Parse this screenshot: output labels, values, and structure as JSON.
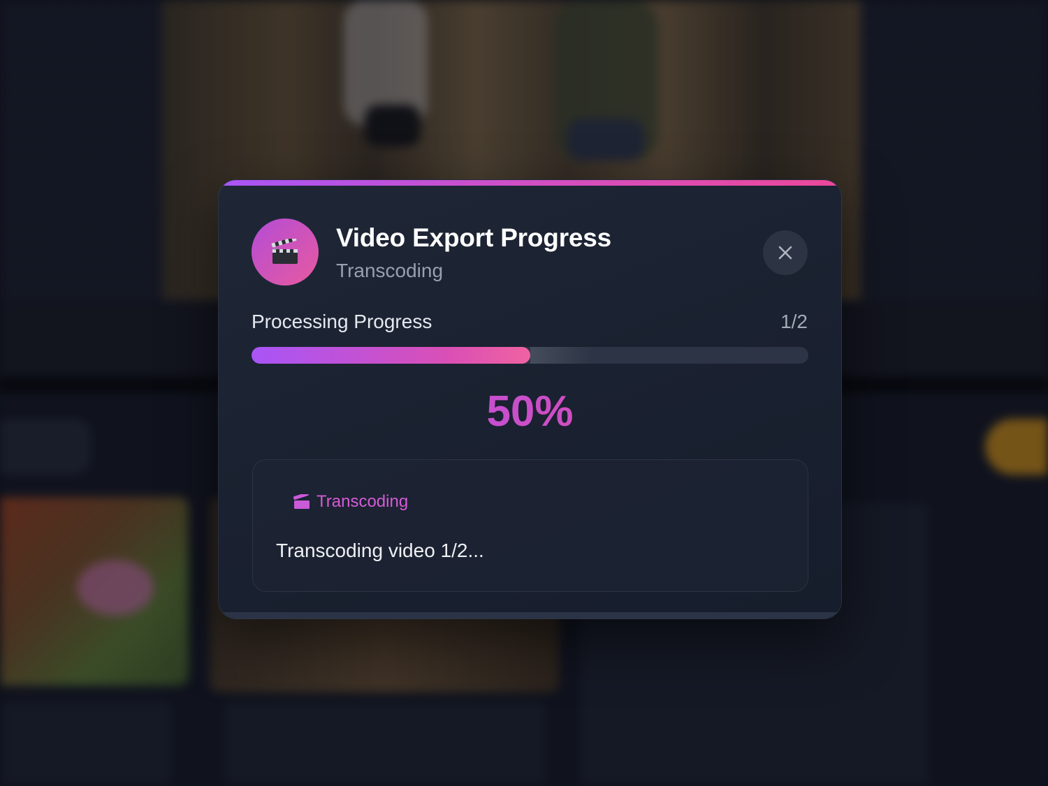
{
  "modal": {
    "title": "Video Export Progress",
    "subtitle": "Transcoding",
    "app_icon": "clapper-board-icon",
    "close_icon": "close-icon",
    "progress_label": "Processing Progress",
    "progress_count": "1/2",
    "progress_fraction": 0.5,
    "percent_text": "50%",
    "status_tag": "Transcoding",
    "status_tag_icon": "clapper-icon",
    "status_message": "Transcoding video 1/2..."
  },
  "colors": {
    "accent_start": "#a855f7",
    "accent_end": "#ec4899",
    "status_tag": "#d45bd6",
    "modal_bg": "#1a2130"
  }
}
